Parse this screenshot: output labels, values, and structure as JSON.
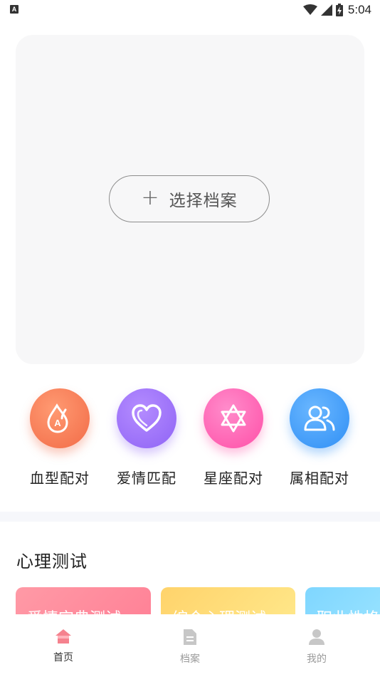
{
  "status_bar": {
    "time": "5:04",
    "left_icon_letter": "A"
  },
  "profile_card": {
    "select_label": "选择档案",
    "plus_symbol": "+"
  },
  "features": [
    {
      "label": "血型配对",
      "icon": "blood-drop-icon",
      "color": "#f26b47",
      "glyph": "A"
    },
    {
      "label": "爱情匹配",
      "icon": "heart-icon",
      "color": "#8f63f5"
    },
    {
      "label": "星座配对",
      "icon": "hexagram-star-icon",
      "color": "#ff4fa7"
    },
    {
      "label": "属相配对",
      "icon": "two-people-icon",
      "color": "#2f8ff5"
    }
  ],
  "section": {
    "title": "心理测试"
  },
  "tests": [
    {
      "label": "爱情宝典测试"
    },
    {
      "label": "综合心理测试"
    },
    {
      "label": "职业性格测"
    }
  ],
  "nav": [
    {
      "label": "首页",
      "icon": "home-icon",
      "active": true,
      "color": "#f5828e"
    },
    {
      "label": "档案",
      "icon": "document-icon",
      "active": false,
      "color": "#c7c7c7"
    },
    {
      "label": "我的",
      "icon": "person-icon",
      "active": false,
      "color": "#c7c7c7"
    }
  ]
}
